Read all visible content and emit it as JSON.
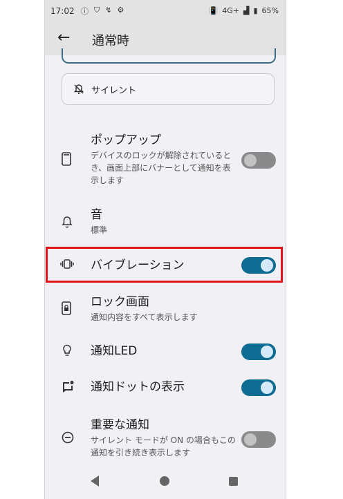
{
  "status_bar": {
    "time": "17:02",
    "network": "4G+",
    "battery": "65%"
  },
  "app_bar": {
    "title": "通常時"
  },
  "silent_button": {
    "label": "サイレント"
  },
  "settings": [
    {
      "id": "popup",
      "title": "ポップアップ",
      "subtitle": "デバイスのロックが解除されているとき、画面上部にバナーとして通知を表示します",
      "toggle": false
    },
    {
      "id": "sound",
      "title": "音",
      "subtitle": "標準"
    },
    {
      "id": "vibration",
      "title": "バイブレーション",
      "toggle": true
    },
    {
      "id": "lockscreen",
      "title": "ロック画面",
      "subtitle": "通知内容をすべて表示します"
    },
    {
      "id": "led",
      "title": "通知LED",
      "toggle": true
    },
    {
      "id": "dot",
      "title": "通知ドットの表示",
      "toggle": true
    },
    {
      "id": "important",
      "title": "重要な通知",
      "subtitle": "サイレント モードが ON の場合もこの通知を引き続き表示します",
      "toggle": false
    }
  ],
  "colors": {
    "accent": "#0e6b92",
    "highlight": "#e3131b"
  }
}
